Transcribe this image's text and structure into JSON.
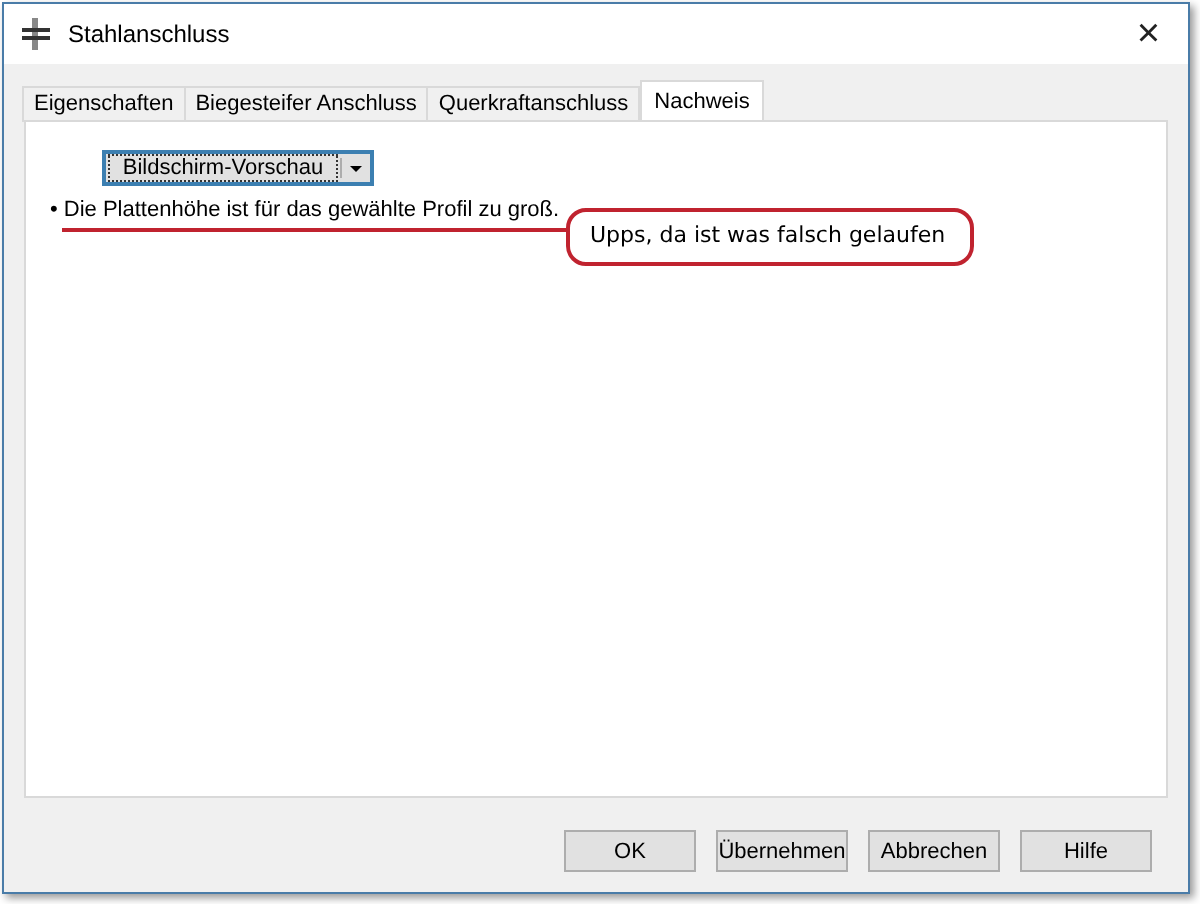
{
  "window": {
    "title": "Stahlanschluss",
    "close": "×"
  },
  "tabs": [
    {
      "label": "Eigenschaften",
      "selected": false
    },
    {
      "label": "Biegesteifer Anschluss",
      "selected": false
    },
    {
      "label": "Querkraftanschluss",
      "selected": false
    },
    {
      "label": "Nachweis",
      "selected": true
    }
  ],
  "output_select": {
    "value": "Bildschirm-Vorschau",
    "focused": true
  },
  "messages": [
    "• Die Plattenhöhe ist für das gewählte Profil zu groß."
  ],
  "annotation": {
    "text": "Upps, da ist was falsch gelaufen",
    "color": "#c0232f"
  },
  "buttons": [
    "OK",
    "Übernehmen",
    "Abbrechen",
    "Hilfe"
  ]
}
